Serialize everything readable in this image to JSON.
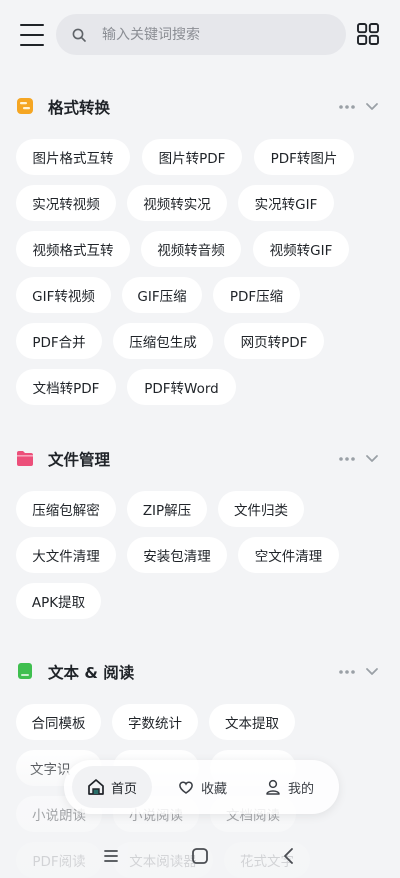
{
  "search": {
    "placeholder": "输入关键词搜索"
  },
  "sections": [
    {
      "title": "格式转换",
      "icon": "format-convert-icon",
      "items": [
        "图片格式互转",
        "图片转PDF",
        "PDF转图片",
        "实况转视频",
        "视频转实况",
        "实况转GIF",
        "视频格式互转",
        "视频转音频",
        "视频转GIF",
        "GIF转视频",
        "GIF压缩",
        "PDF压缩",
        "PDF合并",
        "压缩包生成",
        "网页转PDF",
        "文档转PDF",
        "PDF转Word"
      ]
    },
    {
      "title": "文件管理",
      "icon": "file-management-icon",
      "items": [
        "压缩包解密",
        "ZIP解压",
        "文件归类",
        "大文件清理",
        "安装包清理",
        "空文件清理",
        "APK提取"
      ]
    },
    {
      "title": "文本 & 阅读",
      "icon": "text-reading-icon",
      "items": [
        "合同模板",
        "字数统计",
        "文本提取",
        "文字识",
        "小说朗读",
        "小说阅读",
        "文档阅读",
        "PDF阅读",
        "文本阅读器",
        "花式文字"
      ]
    }
  ],
  "bottom_nav": [
    {
      "label": "首页",
      "icon": "home-icon",
      "active": true
    },
    {
      "label": "收藏",
      "icon": "favorite-icon",
      "active": false
    },
    {
      "label": "我的",
      "icon": "profile-icon",
      "active": false
    }
  ],
  "colors": {
    "background": "#f3f4f6",
    "chip": "#ffffff",
    "format_icon": "#f5a623",
    "file_icon": "#ec4f7a",
    "text_icon": "#3fbf4f"
  }
}
